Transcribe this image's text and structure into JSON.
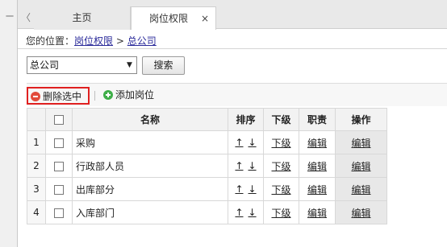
{
  "sidebar_pin": "㆒",
  "tabs": {
    "scroll_left": "〈",
    "home": "主页",
    "active": "岗位权限",
    "close": "×"
  },
  "breadcrumb": {
    "prefix": "您的位置：",
    "item1": "岗位权限",
    "sep": ">",
    "item2": "总公司"
  },
  "search": {
    "selected": "总公司",
    "button": "搜索"
  },
  "toolbar": {
    "delete_label": "删除选中",
    "add_label": "添加岗位"
  },
  "table": {
    "headers": {
      "name": "名称",
      "sort": "排序",
      "sub": "下级",
      "duty": "职责",
      "ops": "操作"
    },
    "rows": [
      {
        "num": "1",
        "name": "采购",
        "up": "↑",
        "down": "↓",
        "sub": "下级",
        "duty": "编辑",
        "op": "编辑"
      },
      {
        "num": "2",
        "name": "行政部人员",
        "up": "↑",
        "down": "↓",
        "sub": "下级",
        "duty": "编辑",
        "op": "编辑"
      },
      {
        "num": "3",
        "name": "出库部分",
        "up": "↑",
        "down": "↓",
        "sub": "下级",
        "duty": "编辑",
        "op": "编辑"
      },
      {
        "num": "4",
        "name": "入库部门",
        "up": "↑",
        "down": "↓",
        "sub": "下级",
        "duty": "编辑",
        "op": "编辑"
      }
    ]
  },
  "icons": {
    "delete": "minus-circle-icon",
    "add": "plus-circle-icon"
  },
  "colors": {
    "delete_highlight": "#e02020",
    "delete_icon": "#e24b3b",
    "add_icon": "#3fae49"
  }
}
